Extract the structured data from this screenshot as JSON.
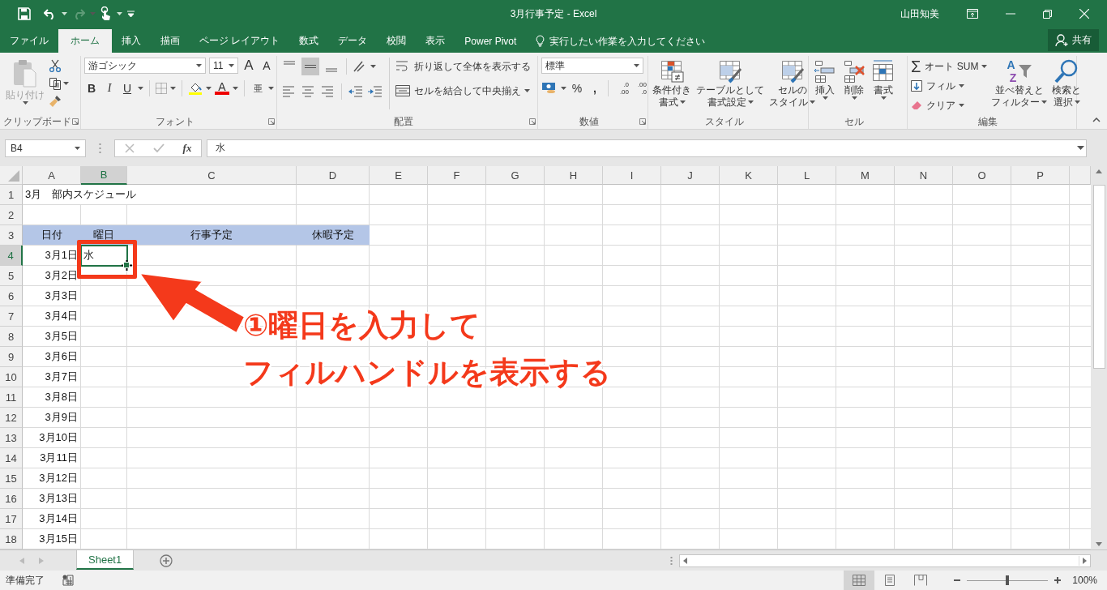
{
  "title_bar": {
    "title": "3月行事予定 - Excel",
    "user": "山田知美"
  },
  "menu_tabs": [
    {
      "label": "ファイル",
      "selected": false
    },
    {
      "label": "ホーム",
      "selected": true
    },
    {
      "label": "挿入",
      "selected": false
    },
    {
      "label": "描画",
      "selected": false
    },
    {
      "label": "ページ レイアウト",
      "selected": false
    },
    {
      "label": "数式",
      "selected": false
    },
    {
      "label": "データ",
      "selected": false
    },
    {
      "label": "校閲",
      "selected": false
    },
    {
      "label": "表示",
      "selected": false
    },
    {
      "label": "Power Pivot",
      "selected": false
    }
  ],
  "tell_me": {
    "placeholder": "実行したい作業を入力してください"
  },
  "share_button": "共有",
  "ribbon": {
    "clipboard": {
      "paste": "貼り付け",
      "label": "クリップボード"
    },
    "font": {
      "font_name": "游ゴシック",
      "font_size": "11",
      "grow": "A",
      "shrink": "A",
      "bold": "B",
      "italic": "I",
      "underline": "U",
      "font_color": "A",
      "phonetic": "亜",
      "label": "フォント"
    },
    "alignment": {
      "vertical": [
        {
          "selected": false
        },
        {
          "selected": true
        },
        {
          "selected": false
        }
      ],
      "wrap": "折り返して全体を表示する",
      "merge": "セルを結合して中央揃え",
      "label": "配置"
    },
    "number": {
      "format": "標準",
      "percent": "%",
      "comma": ",",
      "decimals": [
        {
          "top": ".0",
          "bottom": ".00"
        },
        {
          "top": ".00",
          "bottom": ".0"
        }
      ],
      "label": "数値"
    },
    "styles": {
      "buttons": [
        {
          "lines": [
            "条件付き",
            "書式"
          ]
        },
        {
          "lines": [
            "テーブルとして",
            "書式設定"
          ]
        },
        {
          "lines": [
            "セルの",
            "スタイル"
          ]
        }
      ],
      "label": "スタイル"
    },
    "cells": {
      "buttons": [
        "挿入",
        "削除",
        "書式"
      ],
      "label": "セル"
    },
    "editing": {
      "sigma": "Σ",
      "autosum": "オート SUM",
      "fill": "フィル",
      "clear": "クリア",
      "sort_letters": [
        "A",
        "Z"
      ],
      "sort": [
        "並べ替えと",
        "フィルター"
      ],
      "find": [
        "検索と",
        "選択"
      ],
      "label": "編集"
    }
  },
  "formula_bar": {
    "name_box": "B4",
    "fx": "fx",
    "formula": "水"
  },
  "columns": [
    {
      "label": "A",
      "selected": false
    },
    {
      "label": "B",
      "selected": true
    },
    {
      "label": "C",
      "selected": false
    },
    {
      "label": "D",
      "selected": false
    },
    {
      "label": "E",
      "selected": false
    },
    {
      "label": "F",
      "selected": false
    },
    {
      "label": "G",
      "selected": false
    },
    {
      "label": "H",
      "selected": false
    },
    {
      "label": "I",
      "selected": false
    },
    {
      "label": "J",
      "selected": false
    },
    {
      "label": "K",
      "selected": false
    },
    {
      "label": "L",
      "selected": false
    },
    {
      "label": "M",
      "selected": false
    },
    {
      "label": "N",
      "selected": false
    },
    {
      "label": "O",
      "selected": false
    },
    {
      "label": "P",
      "selected": false
    }
  ],
  "rows": [
    {
      "number": "1",
      "selected": false,
      "kind": "title",
      "cells": [
        "3月　部内スケジュール"
      ]
    },
    {
      "number": "2",
      "selected": false,
      "cells": []
    },
    {
      "number": "3",
      "selected": false,
      "kind": "header",
      "cells": [
        "日付",
        "曜日",
        "行事予定",
        "休暇予定"
      ]
    },
    {
      "number": "4",
      "selected": true,
      "kind": "data",
      "cells": [
        "3月1日",
        "水"
      ]
    },
    {
      "number": "5",
      "selected": false,
      "kind": "data",
      "cells": [
        "3月2日"
      ]
    },
    {
      "number": "6",
      "selected": false,
      "kind": "data",
      "cells": [
        "3月3日"
      ]
    },
    {
      "number": "7",
      "selected": false,
      "kind": "data",
      "cells": [
        "3月4日"
      ]
    },
    {
      "number": "8",
      "selected": false,
      "kind": "data",
      "cells": [
        "3月5日"
      ]
    },
    {
      "number": "9",
      "selected": false,
      "kind": "data",
      "cells": [
        "3月6日"
      ]
    },
    {
      "number": "10",
      "selected": false,
      "kind": "data",
      "cells": [
        "3月7日"
      ]
    },
    {
      "number": "11",
      "selected": false,
      "kind": "data",
      "cells": [
        "3月8日"
      ]
    },
    {
      "number": "12",
      "selected": false,
      "kind": "data",
      "cells": [
        "3月9日"
      ]
    },
    {
      "number": "13",
      "selected": false,
      "kind": "data",
      "cells": [
        "3月10日"
      ]
    },
    {
      "number": "14",
      "selected": false,
      "kind": "data",
      "cells": [
        "3月11日"
      ]
    },
    {
      "number": "15",
      "selected": false,
      "kind": "data",
      "cells": [
        "3月12日"
      ]
    },
    {
      "number": "16",
      "selected": false,
      "kind": "data",
      "cells": [
        "3月13日"
      ]
    },
    {
      "number": "17",
      "selected": false,
      "kind": "data",
      "cells": [
        "3月14日"
      ]
    },
    {
      "number": "18",
      "selected": false,
      "kind": "data",
      "cells": [
        "3月15日"
      ]
    }
  ],
  "sheet_tabs": [
    {
      "label": "Sheet1",
      "selected": true
    }
  ],
  "status_bar": {
    "status": "準備完了",
    "views": [
      {
        "selected": true
      },
      {
        "selected": false
      },
      {
        "selected": false
      }
    ],
    "zoom_slider": {
      "level": 0.5
    },
    "zoom": "100%"
  },
  "annotation": {
    "lines": [
      "①曜日を入力して",
      "フィルハンドルを表示する"
    ]
  }
}
